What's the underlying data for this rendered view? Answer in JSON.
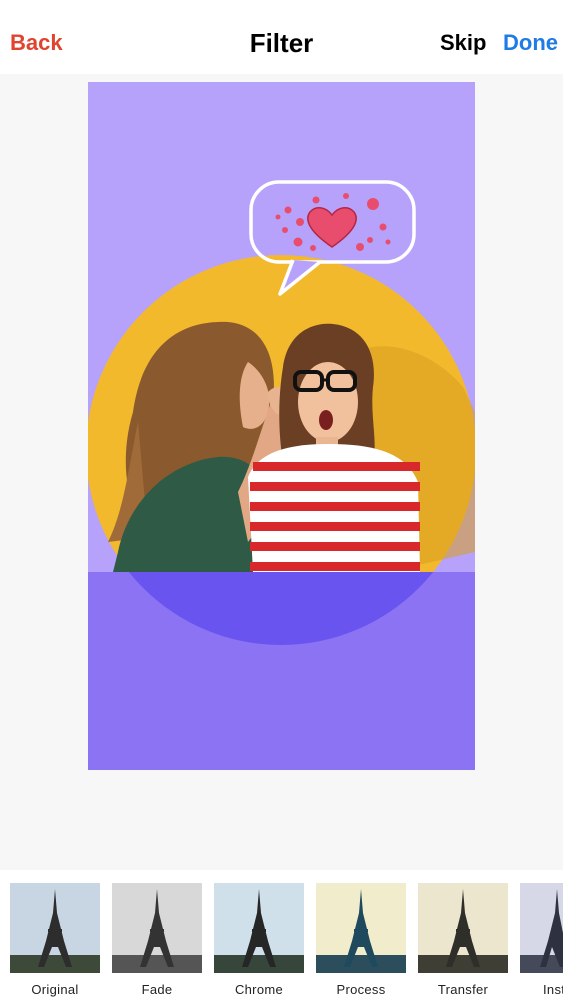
{
  "header": {
    "back_label": "Back",
    "title": "Filter",
    "skip_label": "Skip",
    "done_label": "Done"
  },
  "colors": {
    "back": "#e0442e",
    "done": "#1f7be6",
    "preview_background": "#b6a2fb",
    "preview_floor": "#8b73f4",
    "circle": "#f2b92d",
    "bubble_outline": "#ffffff",
    "heart": "#e94d6d"
  },
  "preview": {
    "image": "two-women-whispering-photo",
    "sticker": "speech-bubble-heart"
  },
  "filters": [
    {
      "label": "Original",
      "tint": "#c7d6e2"
    },
    {
      "label": "Fade",
      "tint": "#d8d8d8"
    },
    {
      "label": "Chrome",
      "tint": "#cfe0ea"
    },
    {
      "label": "Process",
      "tint": "#f1eccb"
    },
    {
      "label": "Transfer",
      "tint": "#ece6cf"
    },
    {
      "label": "Inst",
      "tint": "#d6d8e8"
    }
  ]
}
